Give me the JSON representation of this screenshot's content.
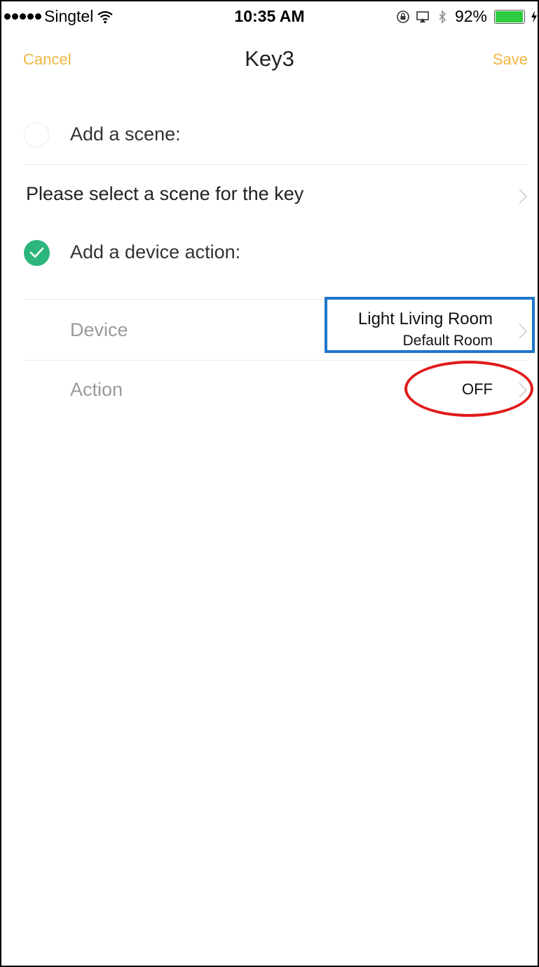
{
  "status_bar": {
    "carrier": "Singtel",
    "time": "10:35 AM",
    "battery_percent": "92%",
    "battery_level": 0.92,
    "icons": [
      "signal-dots-icon",
      "wifi-icon",
      "lock-rotation-icon",
      "airplay-icon",
      "bluetooth-icon",
      "battery-icon",
      "charging-bolt-icon"
    ]
  },
  "nav": {
    "cancel_label": "Cancel",
    "title": "Key3",
    "save_label": "Save"
  },
  "scene_section": {
    "label": "Add a scene:",
    "selected": false,
    "prompt": "Please select a scene for the key"
  },
  "device_section": {
    "label": "Add a device action:",
    "selected": true,
    "device_label": "Device",
    "device_name": "Light Living Room",
    "device_room": "Default Room",
    "action_label": "Action",
    "action_value": "OFF"
  },
  "colors": {
    "accent": "#f0b640",
    "check": "#2cb67d",
    "highlight_box": "#1f76c9",
    "highlight_ring": "#e01a1a"
  }
}
